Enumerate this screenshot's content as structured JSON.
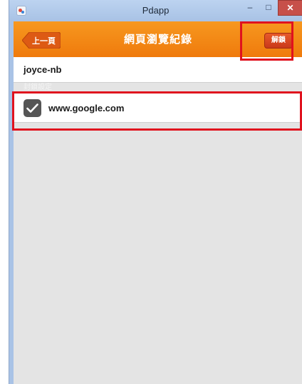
{
  "window": {
    "title": "Pdapp",
    "minimize_glyph": "–",
    "maximize_glyph": "□",
    "close_glyph": "✕"
  },
  "toolbar": {
    "back_label": "上一頁",
    "title": "網頁瀏覽紀錄",
    "unlock_label": "解鎖",
    "accent_color": "#f28a14"
  },
  "content": {
    "device_name": "joyce-nb",
    "section_label": "封鎖設定",
    "items": [
      {
        "url": "www.google.com",
        "checked": true
      }
    ]
  },
  "icons": [
    "app-icon",
    "back-arrow-icon",
    "checkmark-icon",
    "minimize-icon",
    "maximize-icon",
    "close-icon"
  ],
  "highlight_color": "#e0121e"
}
